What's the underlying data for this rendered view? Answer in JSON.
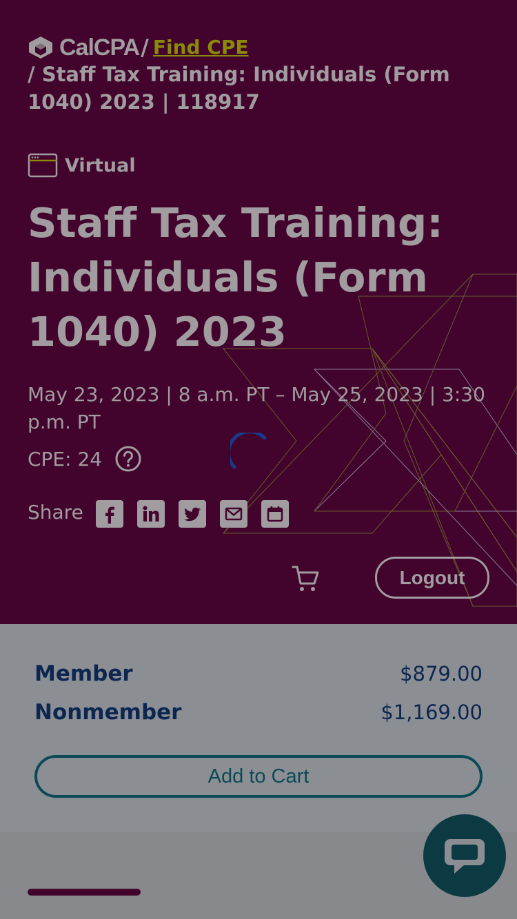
{
  "breadcrumb": {
    "logo_text": "CalCPA",
    "separator": "/",
    "link": "Find CPE",
    "current": "/ Staff Tax Training: Individuals (Form 1040) 2023 | 118917"
  },
  "event": {
    "format": "Virtual",
    "title": "Staff Tax Training: Individuals (Form 1040) 2023",
    "dates": "May 23, 2023 | 8 a.m. PT – May 25, 2023 | 3:30 p.m. PT",
    "cpe": "CPE: 24"
  },
  "share": {
    "label": "Share",
    "icons": [
      "facebook-icon",
      "linkedin-icon",
      "twitter-icon",
      "email-icon",
      "calendar-icon"
    ]
  },
  "header_actions": {
    "logout_label": "Logout"
  },
  "pricing": {
    "rows": [
      {
        "label": "Member",
        "value": "$879.00"
      },
      {
        "label": "Nonmember",
        "value": "$1,169.00"
      }
    ],
    "add_to_cart_label": "Add to Cart"
  },
  "colors": {
    "hero_bg": "#42042c",
    "link": "#8a8a08",
    "navy_text": "#0d2650",
    "teal_button": "#0b4a55",
    "spinner": "#1a3a8a"
  }
}
